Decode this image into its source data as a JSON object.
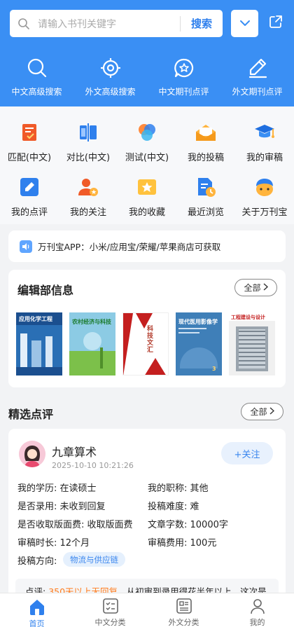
{
  "search": {
    "placeholder": "请输入书刊关键字",
    "button": "搜索"
  },
  "header_nav": [
    {
      "label": "中文高级搜索",
      "icon": "search-icon"
    },
    {
      "label": "外文高级搜索",
      "icon": "crosshair-icon"
    },
    {
      "label": "中文期刊点评",
      "icon": "star-chat-icon"
    },
    {
      "label": "外文期刊点评",
      "icon": "pen-icon"
    }
  ],
  "tools": [
    {
      "label": "匹配(中文)",
      "icon": "match-icon"
    },
    {
      "label": "对比(中文)",
      "icon": "compare-icon"
    },
    {
      "label": "测试(中文)",
      "icon": "test-icon"
    },
    {
      "label": "我的投稿",
      "icon": "submission-icon"
    },
    {
      "label": "我的审稿",
      "icon": "review-hat-icon"
    },
    {
      "label": "我的点评",
      "icon": "comment-edit-icon"
    },
    {
      "label": "我的关注",
      "icon": "follow-user-icon"
    },
    {
      "label": "我的收藏",
      "icon": "favorite-star-icon"
    },
    {
      "label": "最近浏览",
      "icon": "recent-doc-icon"
    },
    {
      "label": "关于万刊宝",
      "icon": "mascot-icon"
    }
  ],
  "notice": {
    "text": "万刊宝APP：小米/应用宝/荣耀/苹果商店可获取"
  },
  "editorial": {
    "title": "编辑部信息",
    "all_label": "全部",
    "covers": [
      {
        "title": "应用化学工程",
        "color": "#2a6fb5"
      },
      {
        "title": "农村经济与科技",
        "color": "#6fb7d8"
      },
      {
        "title": "科技文汇",
        "color": "#ffffff"
      },
      {
        "title": "现代医用影像学",
        "color": "#3f7fb8"
      },
      {
        "title": "工程建设与设计",
        "color": "#f0f0f0"
      }
    ]
  },
  "reviews": {
    "title": "精选点评",
    "all_label": "全部",
    "item": {
      "user": "九章算术",
      "time": "2025-10-10 10:21:26",
      "follow_label": "+关注",
      "fields": {
        "education": "我的学历: 在读硕士",
        "title": "我的职称: 其他",
        "accepted": "是否录用: 未收到回复",
        "difficulty": "投稿难度: 难",
        "page_fee": "是否收取版面费: 收取版面费",
        "word_count": "文章字数: 10000字",
        "review_time": "审稿时长: 12个月",
        "review_fee": "审稿费用: 100元"
      },
      "direction_label": "投稿方向:",
      "direction_tag": "物流与供应链",
      "comment_prefix": "点评:",
      "comment_highlight": "350天以上无回复",
      "comment_rest": "，从初审到录用得花半年以上，这次是"
    }
  },
  "tabbar": [
    {
      "label": "首页",
      "active": true
    },
    {
      "label": "中文分类",
      "active": false
    },
    {
      "label": "外文分类",
      "active": false
    },
    {
      "label": "我的",
      "active": false
    }
  ]
}
